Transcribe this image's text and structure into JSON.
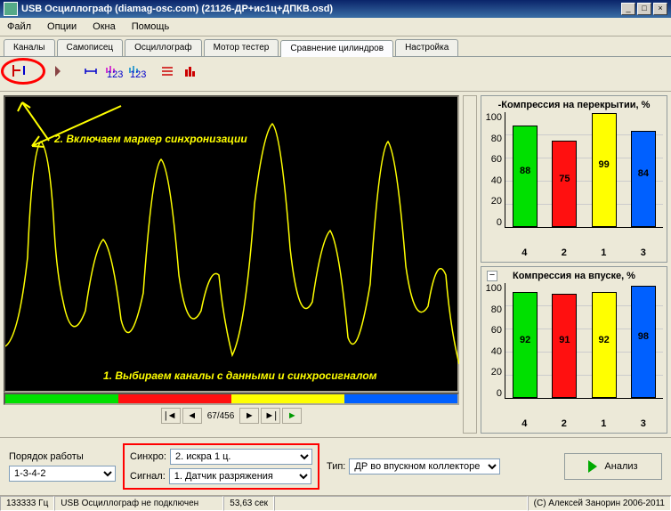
{
  "title": "USB Осциллограф (diamag-osc.com) (21126-ДР+ис1ц+ДПКВ.osd)",
  "menu": [
    "Файл",
    "Опции",
    "Окна",
    "Помощь"
  ],
  "tabs": [
    "Каналы",
    "Самописец",
    "Осциллограф",
    "Мотор тестер",
    "Сравнение цилиндров",
    "Настройка"
  ],
  "active_tab": 4,
  "annotations": {
    "a1": "1. Выбираем каналы с данными и синхросигналом",
    "a2": "2. Включаем маркер синхронизации"
  },
  "pager": "67/456",
  "bottom": {
    "order_label": "Порядок работы",
    "order_value": "1-3-4-2",
    "sync_label": "Синхро:",
    "sync_value": "2. искра 1 ц.",
    "signal_label": "Сигнал:",
    "signal_value": "1. Датчик разряжения",
    "type_label": "Тип:",
    "type_value": "ДР во впускном коллекторе",
    "analyze": "Анализ"
  },
  "status": {
    "freq": "133333  Гц",
    "conn": "USB Осциллограф не подключен",
    "time": "53,63 сек",
    "copy": "(C) Алексей Занорин 2006-2011"
  },
  "chart_data": [
    {
      "type": "bar",
      "title": "-Компрессия на перекрытии, %",
      "categories": [
        "4",
        "2",
        "1",
        "3"
      ],
      "values": [
        88,
        75,
        99,
        84
      ],
      "colors": [
        "#00e000",
        "#ff1010",
        "#ffff00",
        "#0060ff"
      ],
      "ylim": [
        0,
        100
      ],
      "ticks": [
        0,
        20,
        40,
        60,
        80,
        100
      ]
    },
    {
      "type": "bar",
      "title": "Компрессия на впуске, %",
      "has_minus": true,
      "categories": [
        "4",
        "2",
        "1",
        "3"
      ],
      "values": [
        92,
        91,
        92,
        98
      ],
      "colors": [
        "#00e000",
        "#ff1010",
        "#ffff00",
        "#0060ff"
      ],
      "ylim": [
        0,
        100
      ],
      "ticks": [
        0,
        20,
        40,
        60,
        80,
        100
      ]
    }
  ],
  "colorbar": [
    "#00e000",
    "#ff1010",
    "#ffff00",
    "#0060ff"
  ]
}
